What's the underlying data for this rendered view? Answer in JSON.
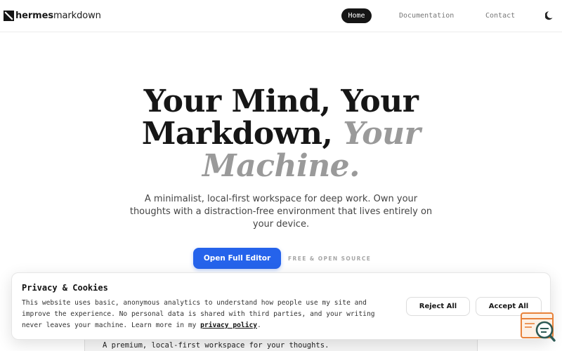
{
  "header": {
    "logo_bold": "hermes",
    "logo_rest": "markdown",
    "nav": {
      "home": "Home",
      "documentation": "Documentation",
      "contact": "Contact"
    },
    "theme_icon": "moon-icon"
  },
  "hero": {
    "title_line1": "Your Mind, Your",
    "title_line2": "Markdown,",
    "title_accent_1": "Your",
    "title_accent_2": "Machine.",
    "subtitle": "A minimalist, local-first workspace for deep work. Own your thoughts with a distraction-free environment that lives entirely on your device.",
    "cta_label": "Open Full Editor",
    "badge": "FREE & OPEN SOURCE"
  },
  "preview": {
    "text": "A premium, local-first workspace for your thoughts."
  },
  "cookie": {
    "title": "Privacy & Cookies",
    "text_before": "This website uses basic, anonymous analytics to understand how people use my site and improve the experience. No personal data is shared with third parties, and your writing never leaves your machine. Learn more in my ",
    "link": "privacy policy",
    "text_after": ".",
    "reject": "Reject All",
    "accept": "Accept All"
  },
  "widget": {
    "icon": "feedback-search-icon"
  },
  "colors": {
    "accent": "#2563eb",
    "dark": "#151515",
    "muted": "#9a9a9a",
    "widget": "#e8823a"
  }
}
